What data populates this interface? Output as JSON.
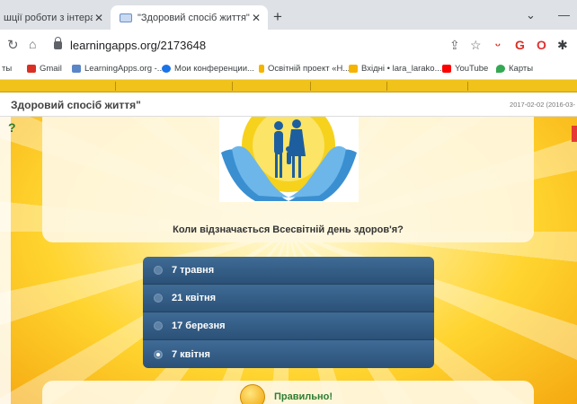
{
  "browser": {
    "tabs": [
      {
        "title": "шції роботи з інтерактив",
        "close": "✕"
      },
      {
        "title": "\"Здоровий спосіб життя\"",
        "close": "✕"
      }
    ],
    "new_tab": "+",
    "minimize": "—",
    "collapse": "⌄",
    "url": "learningapps.org/2173648"
  },
  "bookmarks": [
    {
      "label": "ты",
      "icon_color": "#888888"
    },
    {
      "label": "Gmail",
      "icon_color": "#d93025"
    },
    {
      "label": "LearningApps.org -...",
      "icon_color": "#5a86c8"
    },
    {
      "label": "Мои конференции...",
      "icon_color": "#1a73e8"
    },
    {
      "label": "Освітній проект «Н...",
      "icon_color": "#f4b400"
    },
    {
      "label": "Вхідні • lara_larako...",
      "icon_color": "#f4b400"
    },
    {
      "label": "YouTube",
      "icon_color": "#ff0000"
    },
    {
      "label": "Карты",
      "icon_color": "#34a853"
    }
  ],
  "page": {
    "title": "Здоровий спосіб життя\"",
    "date": "2017-02-02 (2016-03-"
  },
  "app": {
    "help_glyph": "?",
    "question": "Коли відзначається Всесвітній день здоров'я?",
    "options": [
      {
        "label": "7 травня",
        "selected": false
      },
      {
        "label": "21 квітня",
        "selected": false
      },
      {
        "label": "17 березня",
        "selected": false
      },
      {
        "label": "7 квітня",
        "selected": true
      }
    ],
    "feedback": "Правильно!"
  }
}
